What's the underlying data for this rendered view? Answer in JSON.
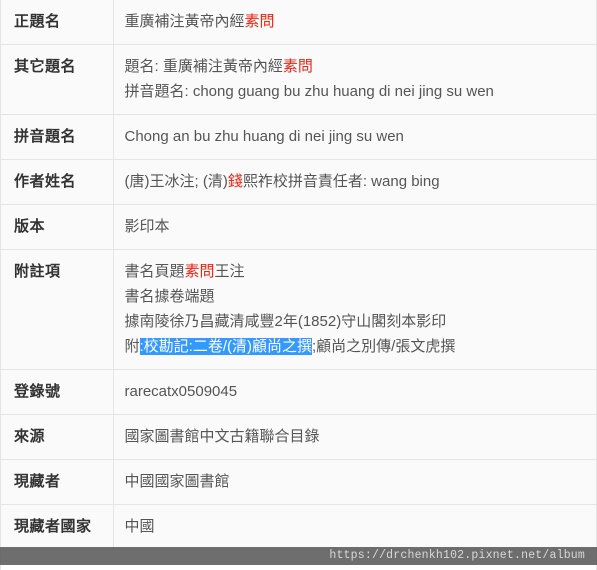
{
  "record": {
    "rows": [
      {
        "label": "正題名",
        "lines": [
          {
            "segments": [
              {
                "text": "重廣補注黃帝內經",
                "style": "normal"
              },
              {
                "text": "素問",
                "style": "red"
              }
            ]
          }
        ]
      },
      {
        "label": "其它題名",
        "lines": [
          {
            "segments": [
              {
                "text": "題名: 重廣補注黃帝內經",
                "style": "normal"
              },
              {
                "text": "素問",
                "style": "red"
              }
            ]
          },
          {
            "segments": [
              {
                "text": "拼音題名: chong guang bu zhu huang di nei jing su wen",
                "style": "normal"
              }
            ]
          }
        ]
      },
      {
        "label": "拼音題名",
        "lines": [
          {
            "segments": [
              {
                "text": "Chong an bu zhu huang di nei jing su wen",
                "style": "normal"
              }
            ]
          }
        ]
      },
      {
        "label": "作者姓名",
        "lines": [
          {
            "segments": [
              {
                "text": "(唐)王冰注; (清)",
                "style": "normal"
              },
              {
                "text": "錢",
                "style": "red"
              },
              {
                "text": "熙祚校拼音責任者: wang bing",
                "style": "normal"
              }
            ]
          }
        ]
      },
      {
        "label": "版本",
        "lines": [
          {
            "segments": [
              {
                "text": "影印本",
                "style": "normal"
              }
            ]
          }
        ]
      },
      {
        "label": "附註項",
        "lines": [
          {
            "segments": [
              {
                "text": "書名頁題",
                "style": "normal"
              },
              {
                "text": "素問",
                "style": "red"
              },
              {
                "text": "王注",
                "style": "normal"
              }
            ]
          },
          {
            "segments": [
              {
                "text": "書名據卷端題",
                "style": "normal"
              }
            ]
          },
          {
            "segments": [
              {
                "text": "據南陵徐乃昌藏清咸豐2年(1852)守山閣刻本影印",
                "style": "normal"
              }
            ]
          },
          {
            "segments": [
              {
                "text": "附",
                "style": "normal"
              },
              {
                "text": ":校勘記:二卷/(清)顧尚之撰",
                "style": "selected"
              },
              {
                "text": ";顧尚之別傳/張文虎撰",
                "style": "normal"
              }
            ]
          }
        ]
      },
      {
        "label": "登錄號",
        "lines": [
          {
            "segments": [
              {
                "text": "rarecatx0509045",
                "style": "normal"
              }
            ]
          }
        ]
      },
      {
        "label": "來源",
        "lines": [
          {
            "segments": [
              {
                "text": "國家圖書館中文古籍聯合目錄",
                "style": "normal"
              }
            ]
          }
        ]
      },
      {
        "label": "現藏者",
        "lines": [
          {
            "segments": [
              {
                "text": "中國國家圖書館",
                "style": "normal"
              }
            ]
          }
        ]
      },
      {
        "label": "現藏者國家",
        "lines": [
          {
            "segments": [
              {
                "text": "中國",
                "style": "normal"
              }
            ]
          }
        ]
      }
    ]
  },
  "watermark": {
    "url": "https://drchenkh102.pixnet.net/album"
  },
  "colors": {
    "highlight_red": "#ee2211",
    "selection_blue": "#3399fe",
    "border": "#e5e5e5",
    "row_background": "#fafafa",
    "watermark_background": "#5a5a5a"
  }
}
